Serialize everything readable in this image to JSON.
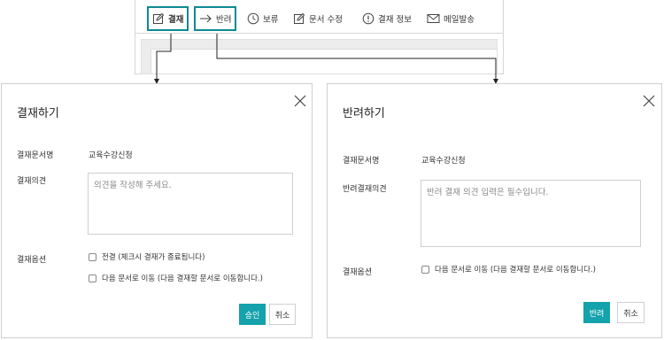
{
  "toolbar": {
    "approve_label": "결재",
    "reject_label": "반려",
    "hold_label": "보류",
    "edit_doc_label": "문서 수정",
    "approval_info_label": "결재 정보",
    "send_mail_label": "메일발송",
    "accent_color": "#0e8a94"
  },
  "approve_dialog": {
    "title": "결재하기",
    "doc_name_label": "결재문서명",
    "doc_name_value": "교육수강신청",
    "opinion_label": "결재의견",
    "opinion_placeholder": "의견을 작성해 주세요.",
    "options_label": "결재옵션",
    "option_final": "전결 (체크시 결재가 종료됩니다)",
    "option_next": "다음 문서로 이동 (다음 결재할 문서로 이동합니다.)",
    "confirm_label": "승인",
    "cancel_label": "취소"
  },
  "reject_dialog": {
    "title": "반려하기",
    "doc_name_label": "결재문서명",
    "doc_name_value": "교육수강신청",
    "opinion_label": "반려결재의견",
    "opinion_placeholder": "반려 결재 의견 입력은 필수입니다.",
    "options_label": "결재옵션",
    "option_next": "다음 문서로 이동 (다음 결재할 문서로 이동합니다.)",
    "confirm_label": "반려",
    "cancel_label": "취소"
  },
  "colors": {
    "primary_button": "#14a2ac",
    "highlight_border": "#0e8a94"
  }
}
